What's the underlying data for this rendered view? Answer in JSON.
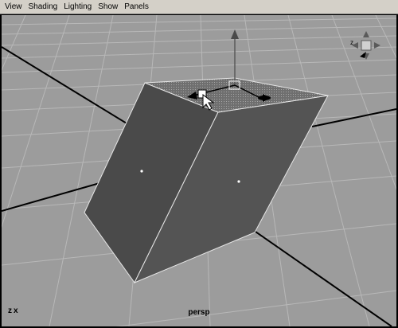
{
  "menubar": {
    "items": [
      "View",
      "Shading",
      "Lighting",
      "Show",
      "Panels"
    ]
  },
  "viewport": {
    "camera_name": "persp",
    "axis_indicator": "z x"
  },
  "icons": {
    "move_manipulator": "move-tool-icon",
    "view_compass": "view-axes-icon",
    "cursor": "arrow-cursor-icon"
  },
  "colors": {
    "viewport_bg": "#9c9c9c",
    "grid_line": "#b6b6b6",
    "object_face": "#505050",
    "selected_face": "#7c7c7c",
    "edge_highlight": "#e6e6e6"
  }
}
